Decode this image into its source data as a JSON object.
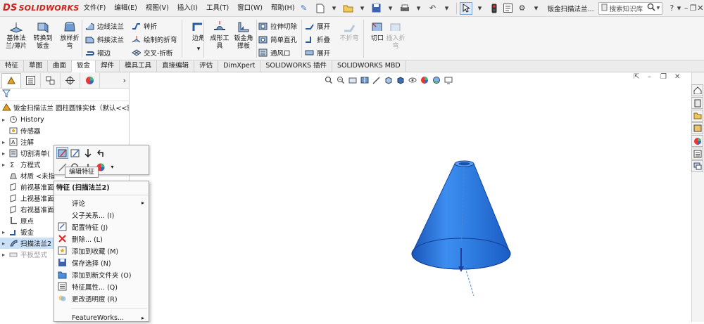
{
  "app": {
    "logo_text": "SOLIDWORKS",
    "logo_mark": "DS",
    "menu": [
      "文件(F)",
      "编辑(E)",
      "视图(V)",
      "插入(I)",
      "工具(T)",
      "窗口(W)",
      "帮助(H)"
    ],
    "document_title": "钣金扫描法兰...",
    "search_placeholder": "搜索知识库",
    "help_label": "?",
    "help_dropdown": "▾"
  },
  "ribbon": {
    "buttons": {
      "base_flange": "基体法\n兰/薄片",
      "convert_to_sheetmetal": "转换到\n钣金",
      "lofted_bend": "放样折\n弯",
      "corners": "边角",
      "formed_tool": "成形工\n具",
      "sheetmetal_gusset": "钣金角\n撑板",
      "no_bends": "不折弯",
      "rip": "切口",
      "insert_bends": "插入折\n弯"
    },
    "small": {
      "edge_flange": "边线法兰",
      "miter_flange": "斜接法兰",
      "hem": "褶边",
      "jog": "转折",
      "sketched_bend": "绘制的折弯",
      "cross_break": "交叉-折断",
      "extruded_cut": "拉伸切除",
      "simple_hole": "简单直孔",
      "vent": "通风口",
      "unfold": "展开",
      "fold": "折叠",
      "flatten": "展开"
    }
  },
  "tabs": [
    "特征",
    "草图",
    "曲面",
    "钣金",
    "焊件",
    "模具工具",
    "直接编辑",
    "评估",
    "DimXpert",
    "SOLIDWORKS 插件",
    "SOLIDWORKS MBD"
  ],
  "active_tab": "钣金",
  "feature_tree": {
    "root": "钣金扫描法兰 圆柱圆锥实体（默认<<默认",
    "items": [
      {
        "label": "History",
        "icon": "history-icon",
        "expand": "▸"
      },
      {
        "label": "传感器",
        "icon": "sensor-icon",
        "expand": ""
      },
      {
        "label": "注解",
        "icon": "annotation-icon",
        "expand": "▸"
      },
      {
        "label": "切割清单(",
        "icon": "cutlist-icon",
        "expand": "▸"
      },
      {
        "label": "方程式",
        "icon": "equation-icon",
        "expand": "▸"
      },
      {
        "label": "材质 <未指",
        "icon": "material-icon",
        "expand": ""
      },
      {
        "label": "前视基准面",
        "icon": "plane-icon",
        "expand": ""
      },
      {
        "label": "上视基准面",
        "icon": "plane-icon",
        "expand": ""
      },
      {
        "label": "右视基准面",
        "icon": "plane-icon",
        "expand": ""
      },
      {
        "label": "原点",
        "icon": "origin-icon",
        "expand": ""
      },
      {
        "label": "钣金",
        "icon": "sheetmetal-icon",
        "expand": "▸"
      },
      {
        "label": "扫描法兰2",
        "icon": "swept-flange-icon",
        "expand": "▸"
      },
      {
        "label": "平板型式",
        "icon": "flat-pattern-icon",
        "expand": "▸"
      }
    ]
  },
  "context_toolbar": {
    "tooltip": "编辑特征"
  },
  "context_menu": {
    "header": "特征 (扫描法兰2)",
    "items": [
      {
        "label": "评论",
        "submenu": true,
        "icon": ""
      },
      {
        "label": "父子关系... (I)",
        "submenu": false,
        "icon": ""
      },
      {
        "label": "配置特征 (J)",
        "submenu": false,
        "icon": "configure-icon"
      },
      {
        "label": "删除... (L)",
        "submenu": false,
        "icon": "delete-icon"
      },
      {
        "label": "添加到收藏 (M)",
        "submenu": false,
        "icon": "favorite-icon"
      },
      {
        "label": "保存选择 (N)",
        "submenu": false,
        "icon": "save-selection-icon"
      },
      {
        "label": "添加到新文件夹 (O)",
        "submenu": false,
        "icon": "folder-icon"
      },
      {
        "label": "特征属性... (Q)",
        "submenu": false,
        "icon": "properties-icon"
      },
      {
        "label": "更改透明度 (R)",
        "submenu": false,
        "icon": "transparency-icon"
      },
      {
        "label": "FeatureWorks...",
        "submenu": true,
        "icon": ""
      }
    ]
  },
  "colors": {
    "accent": "#2e7bd8",
    "cone_fill": "#2f7de0",
    "logo_red": "#d0211c",
    "selection": "#c9e0f7"
  }
}
